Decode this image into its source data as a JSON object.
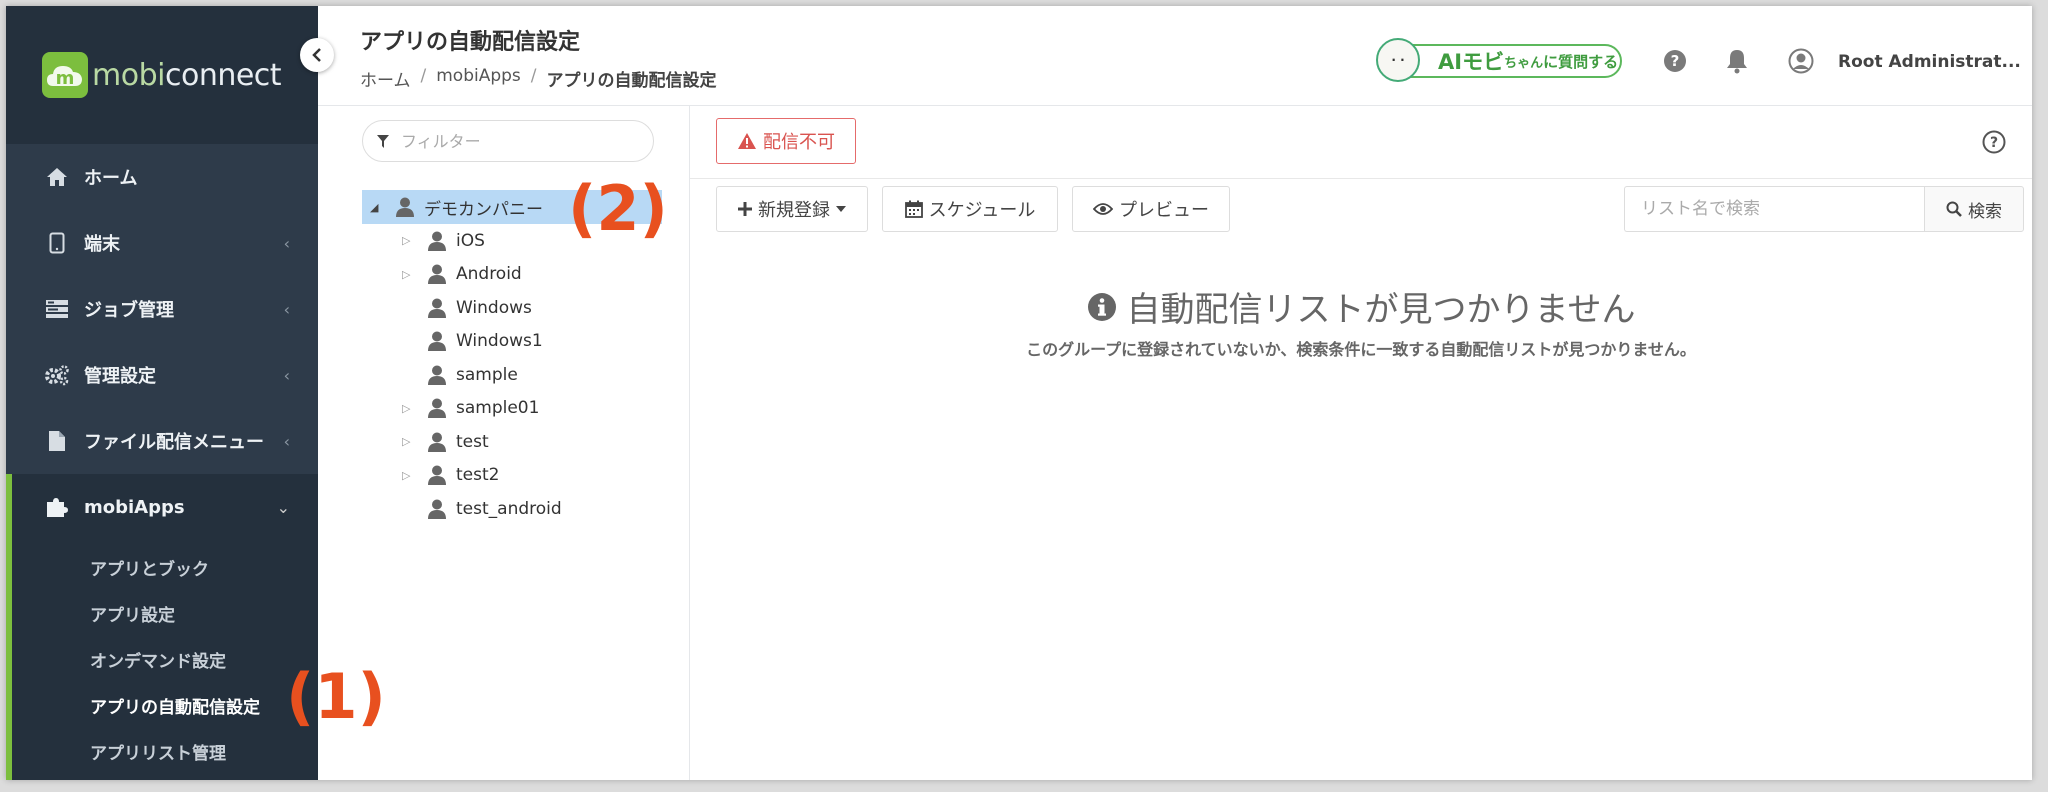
{
  "sidebar": {
    "logo_prefix": "mobi",
    "logo_suffix": "connect",
    "logo_mark": "m",
    "items": [
      {
        "label": "ホーム",
        "icon": "home-icon",
        "has_chevron": false
      },
      {
        "label": "端末",
        "icon": "device-icon",
        "has_chevron": true
      },
      {
        "label": "ジョブ管理",
        "icon": "job-icon",
        "has_chevron": true
      },
      {
        "label": "管理設定",
        "icon": "gears-icon",
        "has_chevron": true
      },
      {
        "label": "ファイル配信メニュー",
        "icon": "file-icon",
        "has_chevron": true
      }
    ],
    "active": {
      "label": "mobiApps",
      "icon": "puzzle-icon"
    },
    "sub_items": [
      "アプリとブック",
      "アプリ設定",
      "オンデマンド設定",
      "アプリの自動配信設定",
      "アプリリスト管理"
    ],
    "chevron_left": "‹",
    "chevron_down": "⌄"
  },
  "header": {
    "title": "アプリの自動配信設定",
    "breadcrumb": [
      "ホーム",
      "mobiApps",
      "アプリの自動配信設定"
    ],
    "breadcrumb_sep": "/",
    "ai_button": {
      "big": "AIモビ",
      "small": "ちゃん",
      "rest": "に質問する"
    },
    "user_name": "Root Administrat..."
  },
  "tree": {
    "filter_placeholder": "フィルター",
    "root": "デモカンパニー",
    "children": [
      {
        "label": "iOS",
        "expandable": true
      },
      {
        "label": "Android",
        "expandable": true
      },
      {
        "label": "Windows",
        "expandable": false
      },
      {
        "label": "Windows1",
        "expandable": false
      },
      {
        "label": "sample",
        "expandable": false
      },
      {
        "label": "sample01",
        "expandable": true
      },
      {
        "label": "test",
        "expandable": true
      },
      {
        "label": "test2",
        "expandable": true
      },
      {
        "label": "test_android",
        "expandable": false
      }
    ]
  },
  "main": {
    "warning_label": "配信不可",
    "buttons": {
      "new": "新規登録",
      "schedule": "スケジュール",
      "preview": "プレビュー",
      "search": "検索"
    },
    "search_placeholder": "リスト名で検索",
    "empty_title": "自動配信リストが見つかりません",
    "empty_desc": "このグループに登録されていないか、検索条件に一致する自動配信リストが見つかりません。"
  },
  "annotations": {
    "marker1": "(1)",
    "marker2": "(2)"
  },
  "colors": {
    "sidebar_bg": "#2e3b4a",
    "accent_green": "#7cbe3e",
    "selected_bg": "#b8d9f5",
    "warning_red": "#d9534f",
    "annotation": "#e8501f"
  }
}
